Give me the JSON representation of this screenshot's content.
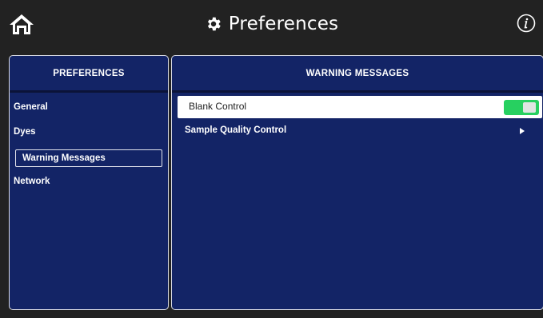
{
  "header": {
    "title": "Preferences",
    "home_icon": "home-icon",
    "title_icon": "gear-icon",
    "info_icon": "info-icon"
  },
  "left_panel": {
    "title": "PREFERENCES",
    "items": [
      {
        "label": "General"
      },
      {
        "label": "Dyes"
      },
      {
        "label": "Warning Messages"
      },
      {
        "label": "Network"
      }
    ],
    "selected": "Warning Messages"
  },
  "right_panel": {
    "title": "WARNING MESSAGES",
    "blank_control": {
      "label": "Blank Control",
      "enabled": true
    },
    "sample_quality_control": {
      "label": "Sample Quality Control",
      "icon": "chevron-right-icon"
    }
  },
  "colors": {
    "background": "#222222",
    "panel": "#132466",
    "toggle_on": "#27d060"
  }
}
